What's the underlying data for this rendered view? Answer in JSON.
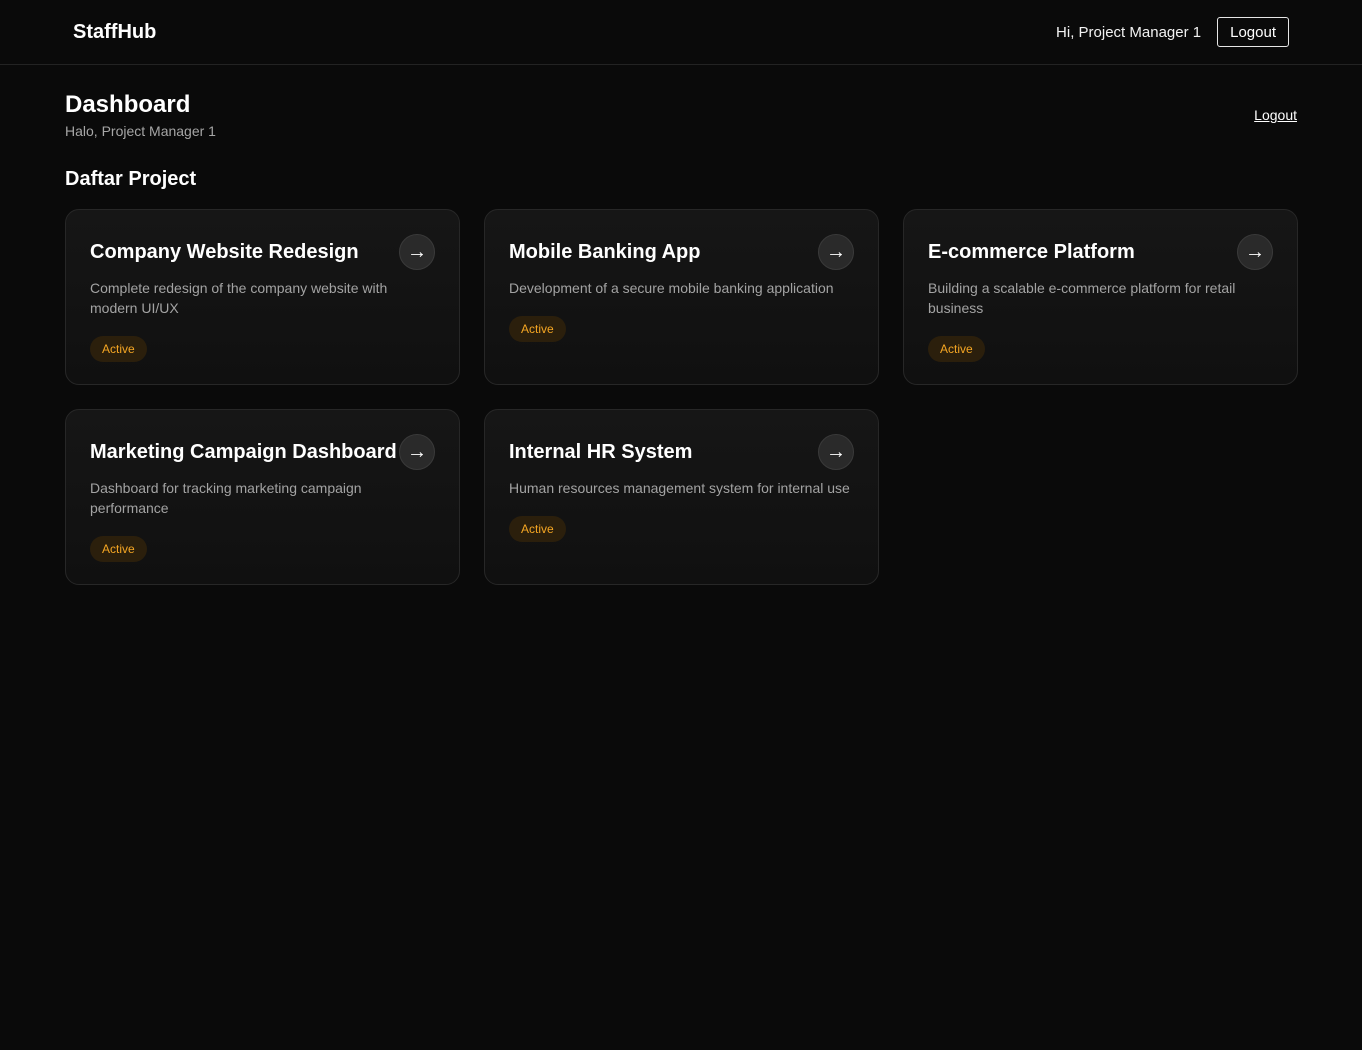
{
  "topbar": {
    "brand": "StaffHub",
    "greeting": "Hi, Project Manager 1",
    "logout_label": "Logout"
  },
  "header": {
    "title": "Dashboard",
    "subtitle": "Halo, Project Manager 1",
    "logout_link": "Logout"
  },
  "section": {
    "title": "Daftar Project"
  },
  "projects": [
    {
      "title": "Company Website Redesign",
      "description": "Complete redesign of the company website with modern UI/UX",
      "status": "Active",
      "arrow": "→"
    },
    {
      "title": "Mobile Banking App",
      "description": "Development of a secure mobile banking application",
      "status": "Active",
      "arrow": "→"
    },
    {
      "title": "E-commerce Platform",
      "description": "Building a scalable e-commerce platform for retail business",
      "status": "Active",
      "arrow": "→"
    },
    {
      "title": "Marketing Campaign Dashboard",
      "description": "Dashboard for tracking marketing campaign performance",
      "status": "Active",
      "arrow": "→"
    },
    {
      "title": "Internal HR System",
      "description": "Human resources management system for internal use",
      "status": "Active",
      "arrow": "→"
    }
  ],
  "colors": {
    "background": "#0a0a0a",
    "status_active_text": "#f5a623",
    "status_active_bg": "#2b1f0c"
  },
  "icons": {
    "card_arrow": "arrow-right-icon"
  }
}
